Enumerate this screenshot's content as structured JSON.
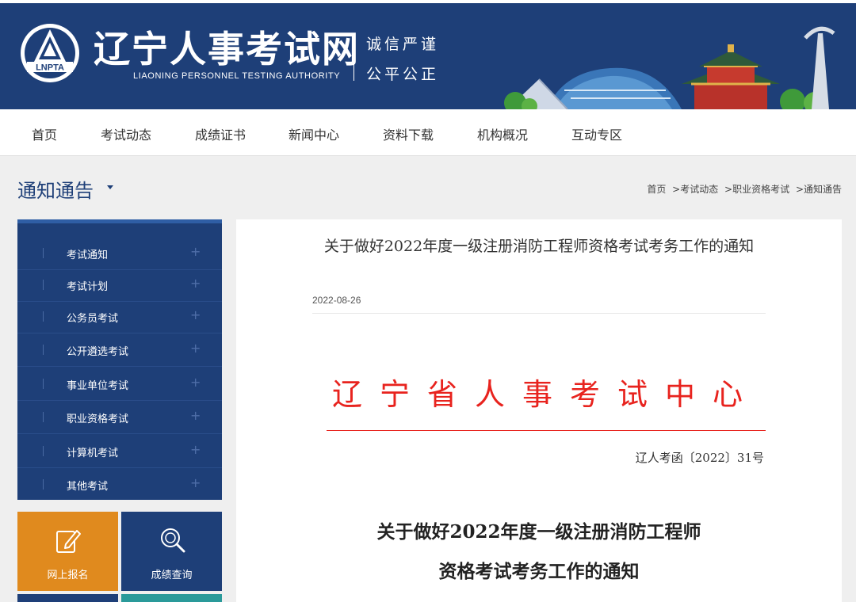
{
  "header": {
    "logo_text": "LNPTA",
    "site_title": "辽宁人事考试网",
    "site_subtitle": "LIAONING PERSONNEL TESTING AUTHORITY",
    "motto_line1": "诚信严谨",
    "motto_line2": "公平公正",
    "brand_color": "#1e3f78"
  },
  "nav": {
    "items": [
      "首页",
      "考试动态",
      "成绩证书",
      "新闻中心",
      "资料下载",
      "机构概况",
      "互动专区"
    ]
  },
  "section": {
    "title": "通知通告",
    "breadcrumb": [
      "首页",
      ">考试动态",
      ">职业资格考试",
      ">通知通告"
    ]
  },
  "sidebar": {
    "items": [
      "考试通知",
      "考试计划",
      "公务员考试",
      "公开遴选考试",
      "事业单位考试",
      "职业资格考试",
      "计算机考试",
      "其他考试"
    ],
    "expand_icon": "plus-icon",
    "tiles": [
      {
        "label": "网上报名",
        "icon": "edit-icon",
        "color": "#e08a1e"
      },
      {
        "label": "成绩查询",
        "icon": "search-icon",
        "color": "#1e3f78"
      }
    ]
  },
  "article": {
    "title": "关于做好2022年度一级注册消防工程师资格考试考务工作的通知",
    "date": "2022-08-26",
    "org_heading": "辽宁省人事考试中心",
    "doc_number": "辽人考函〔2022〕31号",
    "doc_title_line1": "关于做好2022年度一级注册消防工程师",
    "doc_title_line2": "资格考试考务工作的通知",
    "accent_color": "#e8231e"
  }
}
